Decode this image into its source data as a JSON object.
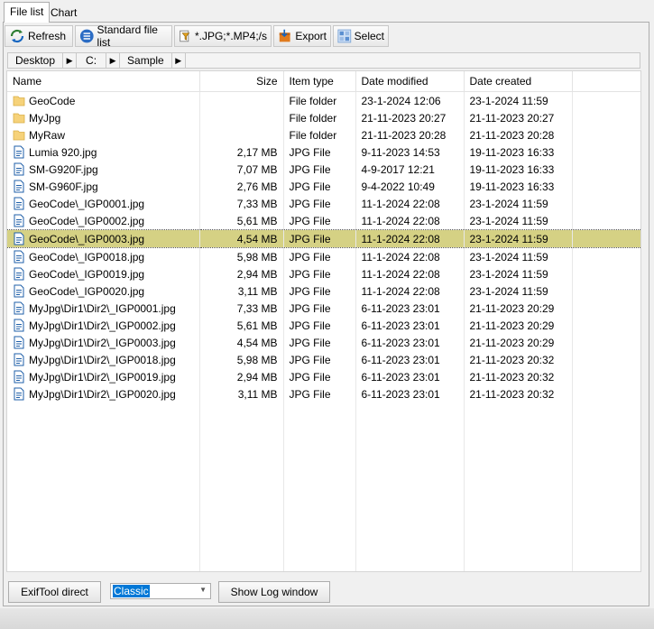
{
  "tabs": [
    {
      "label": "File list"
    },
    {
      "label": "Chart"
    }
  ],
  "toolbar": {
    "refresh": "Refresh",
    "standard_list": "Standard file list",
    "filter": "*.JPG;*.MP4;/s",
    "export": "Export",
    "select": "Select"
  },
  "breadcrumb": [
    "Desktop",
    "C:",
    "Sample"
  ],
  "columns": [
    "Name",
    "Size",
    "Item type",
    "Date modified",
    "Date created"
  ],
  "rows": [
    {
      "type": "folder",
      "name": "GeoCode",
      "size": "",
      "item_type": "File folder",
      "modified": "23-1-2024 12:06",
      "created": "23-1-2024 11:59"
    },
    {
      "type": "folder",
      "name": "MyJpg",
      "size": "",
      "item_type": "File folder",
      "modified": "21-11-2023 20:27",
      "created": "21-11-2023 20:27"
    },
    {
      "type": "folder",
      "name": "MyRaw",
      "size": "",
      "item_type": "File folder",
      "modified": "21-11-2023 20:28",
      "created": "21-11-2023 20:28"
    },
    {
      "type": "file",
      "name": "Lumia 920.jpg",
      "size": "2,17 MB",
      "item_type": "JPG File",
      "modified": "9-11-2023 14:53",
      "created": "19-11-2023 16:33"
    },
    {
      "type": "file",
      "name": "SM-G920F.jpg",
      "size": "7,07 MB",
      "item_type": "JPG File",
      "modified": "4-9-2017 12:21",
      "created": "19-11-2023 16:33"
    },
    {
      "type": "file",
      "name": "SM-G960F.jpg",
      "size": "2,76 MB",
      "item_type": "JPG File",
      "modified": "9-4-2022 10:49",
      "created": "19-11-2023 16:33"
    },
    {
      "type": "file",
      "name": "GeoCode\\_IGP0001.jpg",
      "size": "7,33 MB",
      "item_type": "JPG File",
      "modified": "11-1-2024 22:08",
      "created": "23-1-2024 11:59"
    },
    {
      "type": "file",
      "name": "GeoCode\\_IGP0002.jpg",
      "size": "5,61 MB",
      "item_type": "JPG File",
      "modified": "11-1-2024 22:08",
      "created": "23-1-2024 11:59"
    },
    {
      "type": "file",
      "name": "GeoCode\\_IGP0003.jpg",
      "size": "4,54 MB",
      "item_type": "JPG File",
      "modified": "11-1-2024 22:08",
      "created": "23-1-2024 11:59",
      "selected": true
    },
    {
      "type": "file",
      "name": "GeoCode\\_IGP0018.jpg",
      "size": "5,98 MB",
      "item_type": "JPG File",
      "modified": "11-1-2024 22:08",
      "created": "23-1-2024 11:59"
    },
    {
      "type": "file",
      "name": "GeoCode\\_IGP0019.jpg",
      "size": "2,94 MB",
      "item_type": "JPG File",
      "modified": "11-1-2024 22:08",
      "created": "23-1-2024 11:59"
    },
    {
      "type": "file",
      "name": "GeoCode\\_IGP0020.jpg",
      "size": "3,11 MB",
      "item_type": "JPG File",
      "modified": "11-1-2024 22:08",
      "created": "23-1-2024 11:59"
    },
    {
      "type": "file",
      "name": "MyJpg\\Dir1\\Dir2\\_IGP0001.jpg",
      "size": "7,33 MB",
      "item_type": "JPG File",
      "modified": "6-11-2023 23:01",
      "created": "21-11-2023 20:29"
    },
    {
      "type": "file",
      "name": "MyJpg\\Dir1\\Dir2\\_IGP0002.jpg",
      "size": "5,61 MB",
      "item_type": "JPG File",
      "modified": "6-11-2023 23:01",
      "created": "21-11-2023 20:29"
    },
    {
      "type": "file",
      "name": "MyJpg\\Dir1\\Dir2\\_IGP0003.jpg",
      "size": "4,54 MB",
      "item_type": "JPG File",
      "modified": "6-11-2023 23:01",
      "created": "21-11-2023 20:29"
    },
    {
      "type": "file",
      "name": "MyJpg\\Dir1\\Dir2\\_IGP0018.jpg",
      "size": "5,98 MB",
      "item_type": "JPG File",
      "modified": "6-11-2023 23:01",
      "created": "21-11-2023 20:32"
    },
    {
      "type": "file",
      "name": "MyJpg\\Dir1\\Dir2\\_IGP0019.jpg",
      "size": "2,94 MB",
      "item_type": "JPG File",
      "modified": "6-11-2023 23:01",
      "created": "21-11-2023 20:32"
    },
    {
      "type": "file",
      "name": "MyJpg\\Dir1\\Dir2\\_IGP0020.jpg",
      "size": "3,11 MB",
      "item_type": "JPG File",
      "modified": "6-11-2023 23:01",
      "created": "21-11-2023 20:32"
    }
  ],
  "bottom": {
    "exiftool": "ExifTool direct",
    "mode_value": "Classic",
    "log": "Show Log window"
  },
  "colors": {
    "selected_row": "#d5d184",
    "folder": "#f6d27a",
    "file_icon": "#1f5fa8"
  }
}
